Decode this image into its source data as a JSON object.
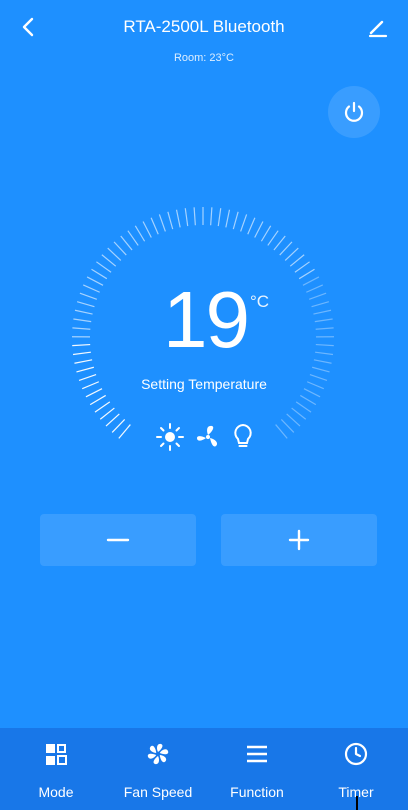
{
  "header": {
    "back_icon": "chevron-left-icon",
    "title": "RTA-2500L Bluetooth",
    "room": "Room: 23°C",
    "edit_icon": "pencil-icon"
  },
  "power_icon": "power-icon",
  "dial": {
    "temperature": "19",
    "unit": "°C",
    "label": "Setting Temperature",
    "mode_icons": [
      "sun-icon",
      "fan-icon",
      "bulb-icon"
    ]
  },
  "stepper": {
    "minus_icon": "minus-icon",
    "plus_icon": "plus-icon"
  },
  "nav": {
    "items": [
      {
        "label": "Mode",
        "icon": "mode-icon"
      },
      {
        "label": "Fan Speed",
        "icon": "fan-speed-icon"
      },
      {
        "label": "Function",
        "icon": "menu-icon"
      },
      {
        "label": "Timer",
        "icon": "clock-icon"
      }
    ]
  },
  "colors": {
    "background": "#1e90ff",
    "nav_background": "#1877e8",
    "foreground": "#ffffff"
  }
}
